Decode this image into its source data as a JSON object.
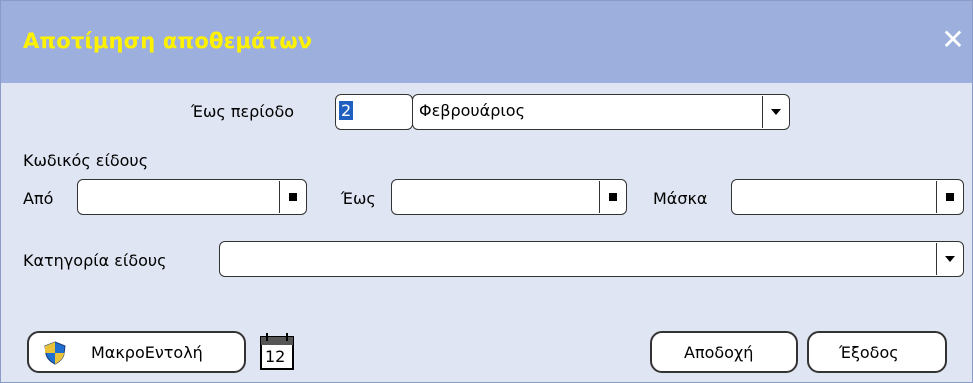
{
  "window": {
    "title": "Αποτίμηση αποθεμάτων",
    "close_symbol": "✕"
  },
  "period": {
    "label": "Έως περίοδο",
    "number": "2",
    "month": "Φεβρουάριος"
  },
  "item_code": {
    "section_label": "Κωδικός είδους",
    "from_label": "Από",
    "from_value": "",
    "to_label": "Έως",
    "to_value": "",
    "mask_label": "Μάσκα",
    "mask_value": ""
  },
  "category": {
    "label": "Κατηγορία είδους",
    "value": ""
  },
  "buttons": {
    "macro_label": "ΜακροΕντολή",
    "calendar_day": "12",
    "accept_label": "Αποδοχή",
    "exit_label": "Έξοδος"
  },
  "colors": {
    "titlebar": "#9db0dd",
    "title_text": "#fff200",
    "background": "#dfe5f2"
  },
  "icons": {
    "macro": "shield-icon",
    "calendar": "calendar-icon",
    "close": "close-icon",
    "lookup": "square-lookup-icon",
    "dropdown": "chevron-down-icon"
  }
}
